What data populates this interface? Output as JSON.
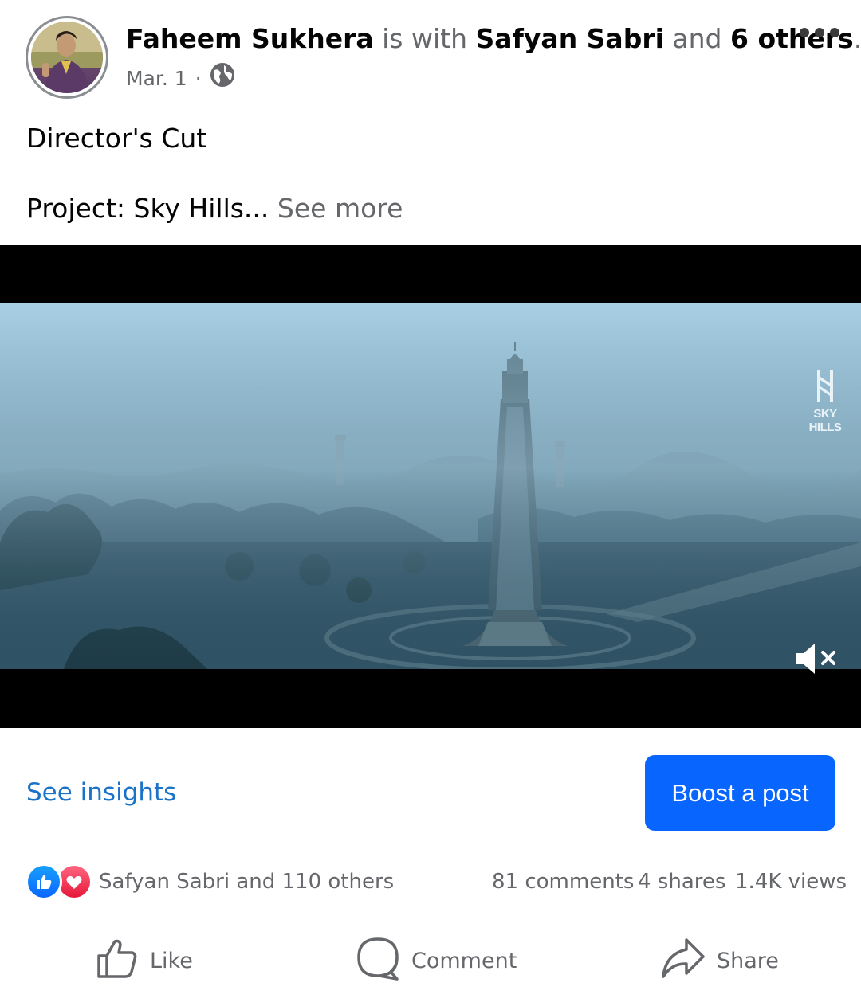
{
  "post": {
    "author": "Faheem Sukhera",
    "with_word": "is with",
    "tagged": "Safyan Sabri",
    "and_word": "and",
    "others": "6 others",
    "period": ".",
    "date": "Mar. 1",
    "dot": "·",
    "privacy_icon": "globe-icon",
    "text_line1": "Director's Cut",
    "text_line2": "Project: Sky Hills...",
    "see_more": "See more"
  },
  "video": {
    "brand": "SKY HILLS",
    "muted": true
  },
  "actions": {
    "see_insights": "See insights",
    "boost": "Boost a post"
  },
  "stats": {
    "reactions_text": "Safyan Sabri and 110 others",
    "comments": "81 comments",
    "shares": "4 shares",
    "views": "1.4K views"
  },
  "buttons": {
    "like": "Like",
    "comment": "Comment",
    "share": "Share"
  },
  "colors": {
    "link": "#1a73c8",
    "boost_bg": "#0866ff",
    "secondary_text": "#65676b"
  }
}
